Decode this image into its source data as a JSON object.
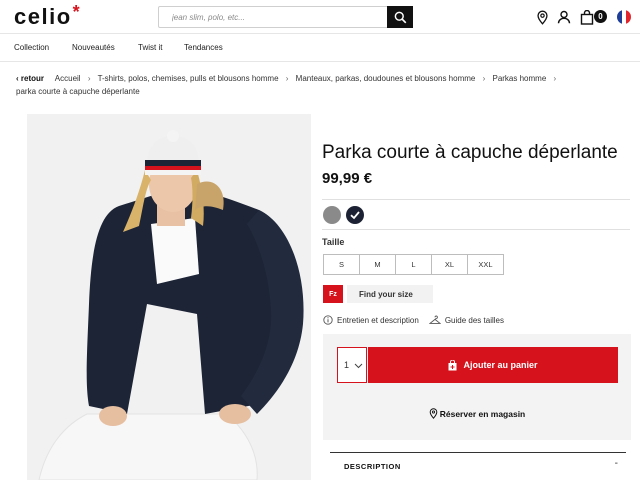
{
  "header": {
    "logo": "celio",
    "logo_star": "*",
    "search_placeholder": "jean slim, polo, etc...",
    "cart_count": "0",
    "icons": [
      "search-icon",
      "store-locator-icon",
      "account-icon",
      "cart-icon",
      "france-flag-icon"
    ]
  },
  "nav": {
    "items": [
      "Collection",
      "Nouveautés",
      "Twist it",
      "Tendances"
    ]
  },
  "breadcrumb": {
    "back": "‹ retour",
    "items": [
      "Accueil",
      "T-shirts, polos, chemises, pulls et blousons homme",
      "Manteaux, parkas, doudounes et blousons homme",
      "Parkas homme",
      "parka courte à capuche déperlante"
    ],
    "separator": "›"
  },
  "product": {
    "title": "Parka courte à capuche déperlante",
    "price": "99,99 €",
    "colors": [
      "#8a8a8a",
      "#1c2233"
    ],
    "selected_color_index": 1,
    "size_label": "Taille",
    "sizes": [
      "S",
      "M",
      "L",
      "XL",
      "XXL"
    ],
    "fit_logo": "Fz",
    "fit_label": "Find your size",
    "info_link": "Entretien et description",
    "guide_link": "Guide des tailles",
    "quantity": "1",
    "add_to_cart": "Ajouter au panier",
    "reserve": "Réserver en magasin",
    "description_label": "DESCRIPTION",
    "description_toggle": "-"
  },
  "colors": {
    "accent": "#d6131c",
    "dark": "#111111"
  }
}
